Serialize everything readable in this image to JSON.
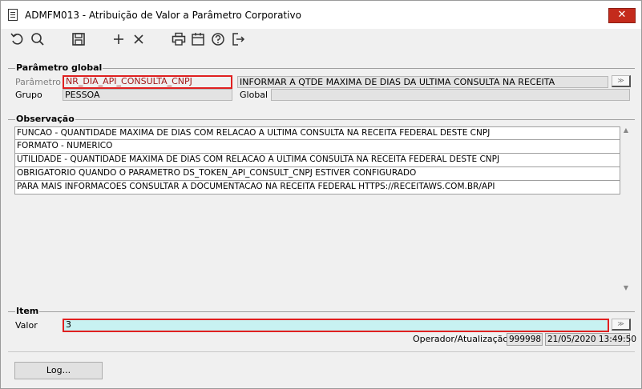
{
  "window": {
    "title": "ADMFM013 - Atribuição de Valor a Parâmetro Corporativo",
    "close_label": "✕"
  },
  "toolbar": {
    "icons": [
      "refresh-icon",
      "search-icon",
      "save-icon",
      "add-icon",
      "delete-icon",
      "print-icon",
      "calendar-icon",
      "help-icon",
      "exit-icon"
    ]
  },
  "parametro_global": {
    "legend": "Parâmetro global",
    "parametro_label": "Parâmetro",
    "parametro_value": "NR_DIA_API_CONSULTA_CNPJ",
    "descricao_value": "INFORMAR A QTDE MAXIMA DE DIAS DA ULTIMA CONSULTA NA RECEITA",
    "grupo_label": "Grupo",
    "grupo_value": "PESSOA",
    "global_label": "Global",
    "global_value": ""
  },
  "observacao": {
    "legend": "Observação",
    "rows": [
      "FUNCAO - QUANTIDADE MAXIMA DE DIAS COM RELACAO A ULTIMA CONSULTA NA RECEITA FEDERAL DESTE CNPJ",
      "FORMATO - NUMERICO",
      "UTILIDADE - QUANTIDADE MAXIMA DE DIAS COM RELACAO A ULTIMA CONSULTA NA RECEITA FEDERAL DESTE CNPJ",
      "OBRIGATORIO QUANDO O PARAMETRO DS_TOKEN_API_CONSULT_CNPJ ESTIVER CONFIGURADO",
      "PARA MAIS INFORMACOES CONSULTAR A DOCUMENTACAO NA RECEITA FEDERAL HTTPS://RECEITAWS.COM.BR/API"
    ]
  },
  "item": {
    "legend": "Item",
    "valor_label": "Valor",
    "valor_value": "3",
    "operador_label": "Operador/Atualização",
    "operador_value": "999998",
    "atualizacao_value": "21/05/2020 13:49:50"
  },
  "footer": {
    "log_label": "Log..."
  },
  "colors": {
    "highlight_border": "#e02020",
    "valor_bg": "#c8f2f2",
    "close_bg": "#c42b1c"
  }
}
